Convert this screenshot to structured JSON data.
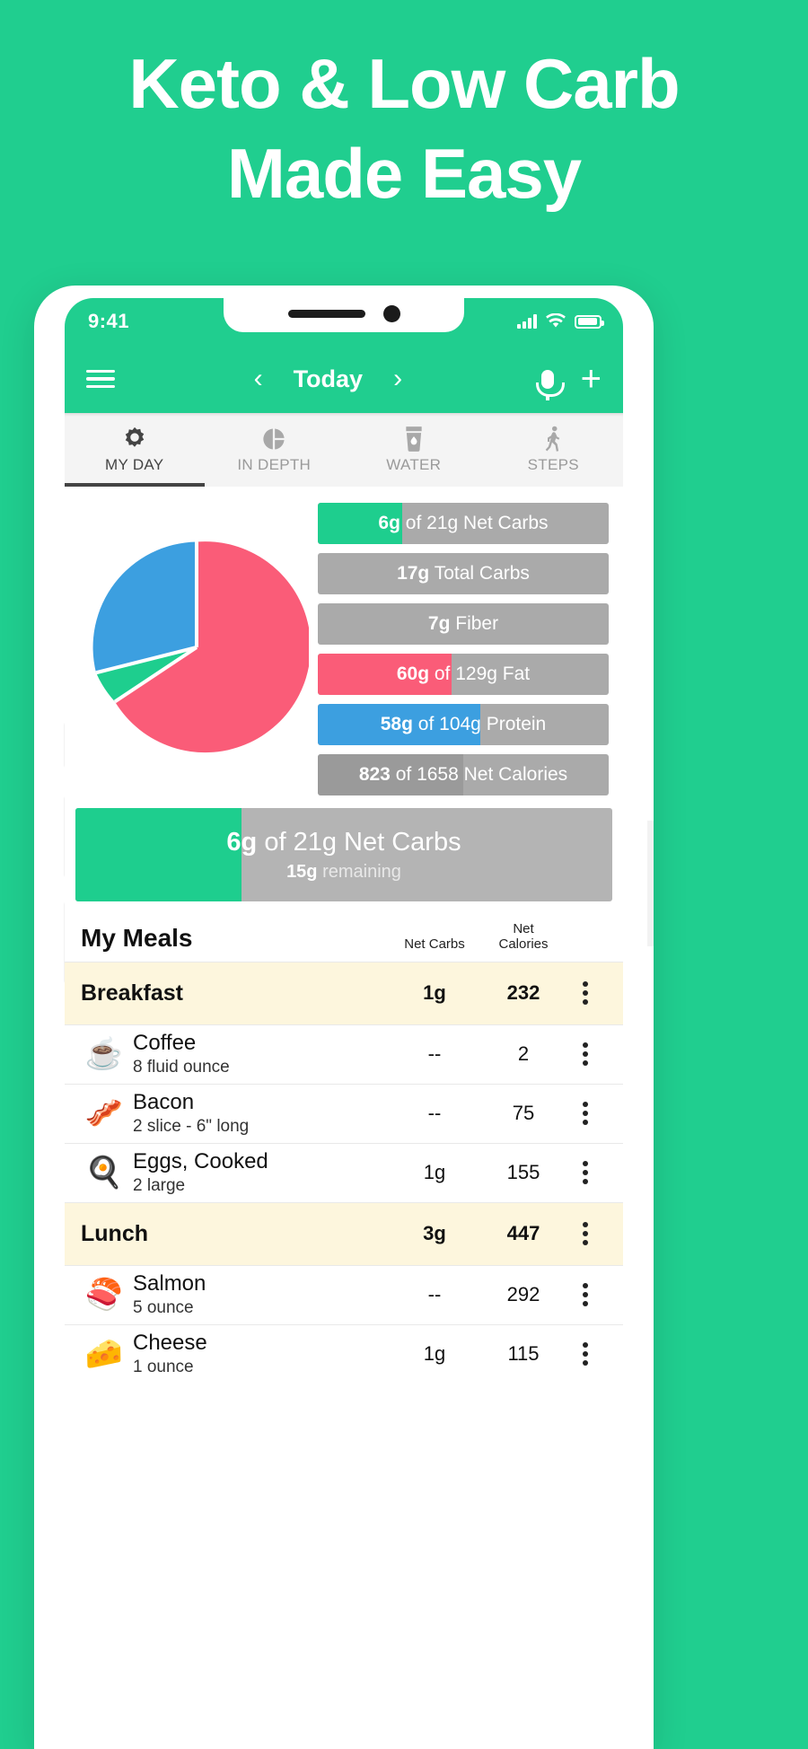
{
  "hero": {
    "line1": "Keto & Low Carb",
    "line2": "Made Easy"
  },
  "colors": {
    "brand_green": "#20CE8F",
    "bar_grey": "#aaaaaa",
    "fat_pink": "#FA5C78",
    "protein_blue": "#2E9FE5",
    "meal_row_cream": "#FDF6DD"
  },
  "status_bar": {
    "time": "9:41",
    "signal_icon": "signal-bars-icon",
    "wifi_icon": "wifi-icon",
    "battery_icon": "battery-icon"
  },
  "toolbar": {
    "menu_icon": "hamburger-menu-icon",
    "prev_icon": "chevron-left-icon",
    "title": "Today",
    "next_icon": "chevron-right-icon",
    "mic_icon": "microphone-icon",
    "add_icon": "plus-icon"
  },
  "tabs": [
    {
      "label": "MY DAY",
      "icon": "sun-gear-icon",
      "active": true
    },
    {
      "label": "IN DEPTH",
      "icon": "pie-chart-icon",
      "active": false
    },
    {
      "label": "WATER",
      "icon": "water-glass-icon",
      "active": false
    },
    {
      "label": "STEPS",
      "icon": "walking-person-icon",
      "active": false
    }
  ],
  "chart_data": {
    "type": "pie",
    "title": "Macronutrient breakdown",
    "categories": [
      "Fat",
      "Protein",
      "Net Carbs"
    ],
    "values": [
      60,
      58,
      6
    ],
    "percentages": [
      64,
      30,
      6
    ],
    "colors": [
      "#FA5C78",
      "#2E9FE5",
      "#1ECE8E"
    ],
    "legend": "none",
    "labels_shown": false
  },
  "macro_bars": [
    {
      "value": "6g",
      "connector": "of",
      "target": "21g",
      "label": "Net Carbs",
      "fill_pct": 29,
      "fill_color": "#1ECE8E",
      "track_color": "#b4b4b4"
    },
    {
      "value": "17g",
      "connector": "",
      "target": "",
      "label": "Total Carbs",
      "fill_pct": 0,
      "fill_color": "",
      "track_color": "#aaaaaa"
    },
    {
      "value": "7g",
      "connector": "",
      "target": "",
      "label": "Fiber",
      "fill_pct": 0,
      "fill_color": "",
      "track_color": "#aaaaaa"
    },
    {
      "value": "60g",
      "connector": "of",
      "target": "129g",
      "label": "Fat",
      "fill_pct": 46,
      "fill_color": "#FA5C78",
      "track_color": "#b4b4b4"
    },
    {
      "value": "58g",
      "connector": "of",
      "target": "104g",
      "label": "Protein",
      "fill_pct": 56,
      "fill_color": "#2E9FE5",
      "track_color": "#b4b4b4"
    },
    {
      "value": "823",
      "connector": "of",
      "target": "1658",
      "label": "Net Calories",
      "fill_pct": 50,
      "fill_color": "#9a9a9a",
      "track_color": "#b4b4b4"
    }
  ],
  "summary": {
    "value": "6g",
    "connector": "of",
    "target": "21g",
    "label": "Net Carbs",
    "remaining_value": "15g",
    "remaining_label": "remaining",
    "fill_pct": 31
  },
  "meals": {
    "title": "My Meals",
    "columns": {
      "net_carbs": "Net Carbs",
      "calories_line1": "Net",
      "calories_line2": "Calories"
    },
    "rows": [
      {
        "kind": "meal",
        "name": "Breakfast",
        "net_carbs": "1g",
        "calories": "232",
        "menu_icon": "kebab-menu-icon"
      },
      {
        "kind": "food",
        "icon": "☕",
        "icon_name": "coffee-icon",
        "name": "Coffee",
        "serving": "8 fluid ounce",
        "net_carbs": "--",
        "calories": "2",
        "menu_icon": "kebab-menu-icon"
      },
      {
        "kind": "food",
        "icon": "🥓",
        "icon_name": "bacon-icon",
        "name": "Bacon",
        "serving": "2 slice - 6\" long",
        "net_carbs": "--",
        "calories": "75",
        "menu_icon": "kebab-menu-icon"
      },
      {
        "kind": "food",
        "icon": "🍳",
        "icon_name": "eggs-icon",
        "name": "Eggs, Cooked",
        "serving": "2 large",
        "net_carbs": "1g",
        "calories": "155",
        "menu_icon": "kebab-menu-icon"
      },
      {
        "kind": "meal",
        "name": "Lunch",
        "net_carbs": "3g",
        "calories": "447",
        "menu_icon": "kebab-menu-icon"
      },
      {
        "kind": "food",
        "icon": "🍣",
        "icon_name": "salmon-icon",
        "name": "Salmon",
        "serving": "5 ounce",
        "net_carbs": "--",
        "calories": "292",
        "menu_icon": "kebab-menu-icon"
      },
      {
        "kind": "food",
        "icon": "🧀",
        "icon_name": "cheese-icon",
        "name": "Cheese",
        "serving": "1 ounce",
        "net_carbs": "1g",
        "calories": "115",
        "menu_icon": "kebab-menu-icon"
      }
    ]
  }
}
